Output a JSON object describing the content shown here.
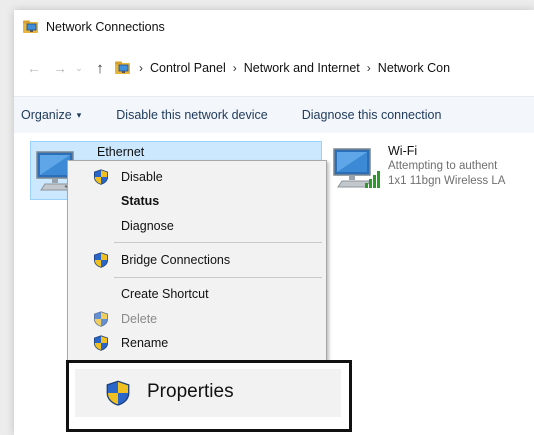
{
  "window": {
    "title": "Network Connections"
  },
  "address_bar": {
    "back": "←",
    "forward": "→",
    "recent": "⌄",
    "up": "↑",
    "separator": "›",
    "crumbs": [
      "Control Panel",
      "Network and Internet",
      "Network Con"
    ]
  },
  "command_bar": {
    "organize": "Organize",
    "organize_arrow": "▾",
    "disable": "Disable this network device",
    "diagnose": "Diagnose this connection"
  },
  "connections": {
    "ethernet": {
      "name": "Ethernet"
    },
    "wifi": {
      "name": "Wi-Fi",
      "status": "Attempting to authent",
      "adapter": "1x1 11bgn Wireless LA"
    }
  },
  "context_menu": {
    "items": [
      {
        "label": "Disable"
      },
      {
        "label": "Status"
      },
      {
        "label": "Diagnose"
      },
      {
        "label": "Bridge Connections"
      },
      {
        "label": "Create Shortcut"
      },
      {
        "label": "Delete"
      },
      {
        "label": "Rename"
      }
    ],
    "properties_label": "Properties"
  },
  "colors": {
    "selection": "#cce8ff",
    "selection_border": "#99d1ff",
    "shield_blue": "#2a66c9",
    "shield_yellow": "#f0c020",
    "callout_border": "#111111"
  }
}
